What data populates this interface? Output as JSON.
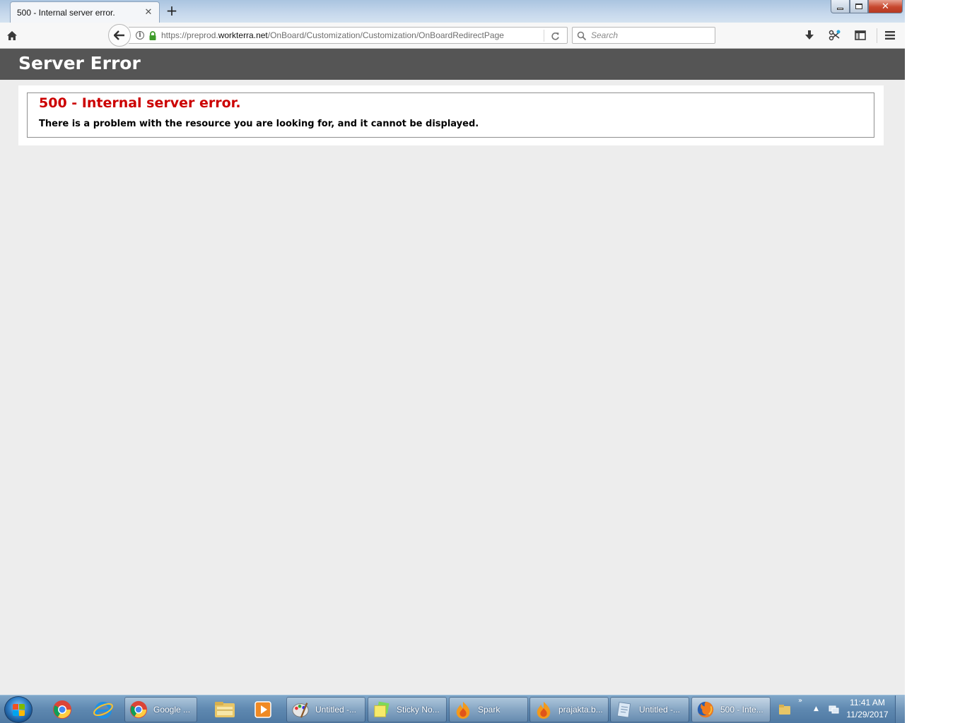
{
  "browser": {
    "tab": {
      "title": "500 - Internal server error."
    },
    "url": {
      "prefix": "https://preprod.",
      "domain": "workterra.net",
      "path": "/OnBoard/Customization/Customization/OnBoardRedirectPage"
    },
    "search": {
      "placeholder": "Search"
    }
  },
  "page": {
    "header_title": "Server Error",
    "error_heading": "500 - Internal server error.",
    "error_message": "There is a problem with the resource you are looking for, and it cannot be displayed."
  },
  "taskbar": {
    "items": [
      {
        "label": "Google ...",
        "icon": "chrome-icon"
      },
      {
        "label": "Untitled -...",
        "icon": "paint-icon"
      },
      {
        "label": "Sticky No...",
        "icon": "sticky-notes-icon"
      },
      {
        "label": "Spark",
        "icon": "spark-icon"
      },
      {
        "label": "prajakta.b...",
        "icon": "spark-icon"
      },
      {
        "label": "Untitled -...",
        "icon": "notepad-icon"
      },
      {
        "label": "500 - Inte...",
        "icon": "firefox-icon"
      }
    ],
    "clock": {
      "time": "11:41 AM",
      "date": "11/29/2017"
    }
  },
  "colors": {
    "header_bg": "#555555",
    "error_red": "#cc0000",
    "page_bg": "#ededed"
  }
}
